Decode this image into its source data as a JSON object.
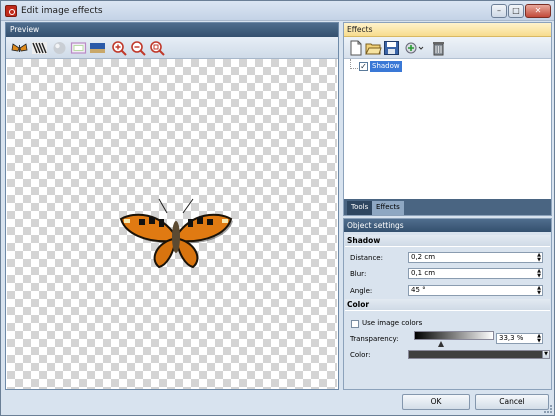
{
  "window": {
    "title": "Edit image effects",
    "min": "–",
    "max": "□",
    "close": "✕"
  },
  "preview": {
    "header": "Preview"
  },
  "effects": {
    "header": "Effects",
    "tree": [
      {
        "label": "Shadow",
        "checked": true
      }
    ],
    "tabs": [
      "Tools",
      "Effects"
    ]
  },
  "settings": {
    "header": "Object settings",
    "shadow_section": "Shadow",
    "distance_label": "Distance:",
    "distance_value": "0,2 cm",
    "blur_label": "Blur:",
    "blur_value": "0,1 cm",
    "angle_label": "Angle:",
    "angle_value": "45 °",
    "color_section": "Color",
    "use_colors_label": "Use image colors",
    "transparency_label": "Transparency:",
    "transparency_value": "33,3 %",
    "transparency_fraction": 0.333,
    "color_label": "Color:",
    "shadow_color": "#3f3f3f"
  },
  "footer": {
    "ok": "OK",
    "cancel": "Cancel"
  }
}
